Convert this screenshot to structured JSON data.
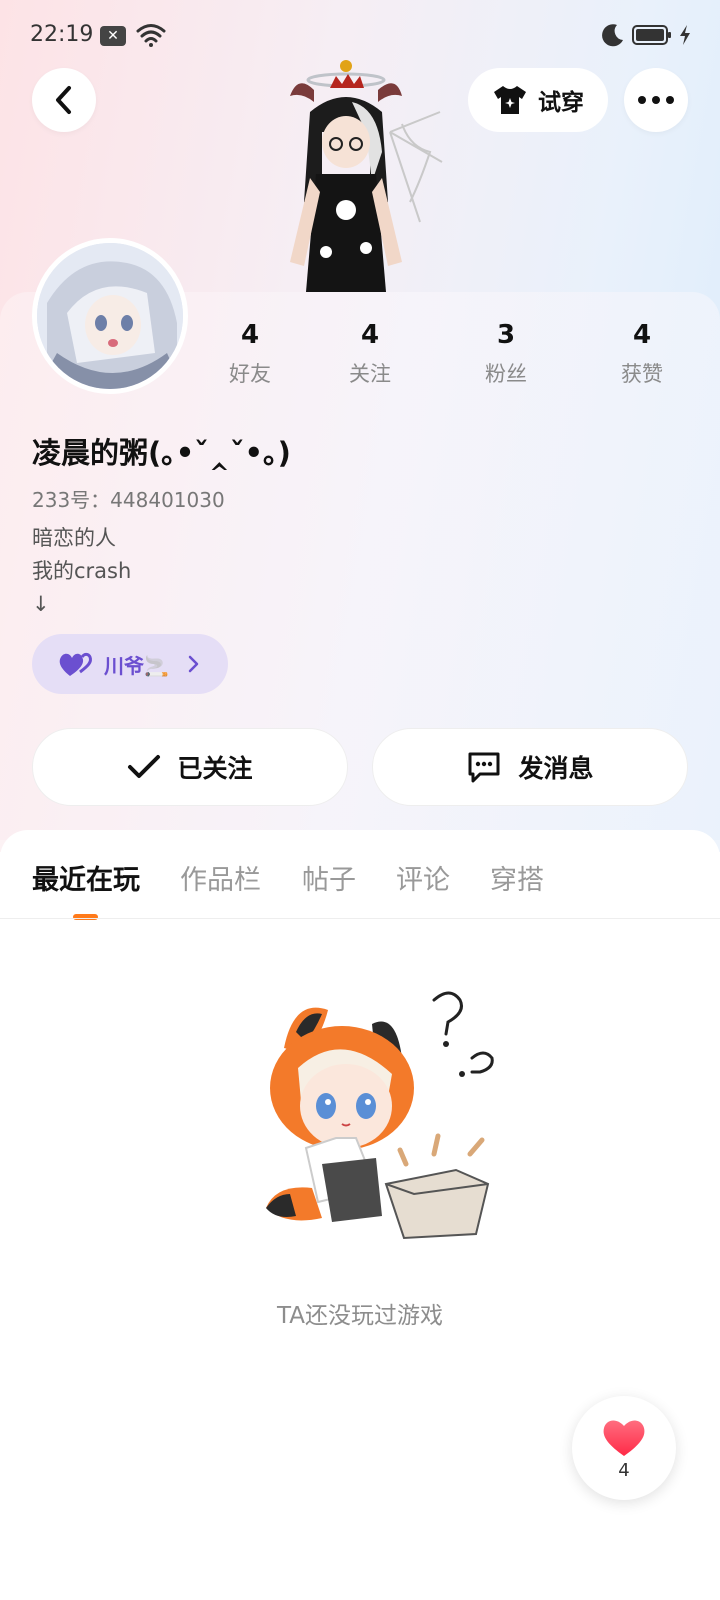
{
  "status_bar": {
    "time": "22:19",
    "notification_icon": "x-box-icon",
    "icons": [
      "wifi-icon",
      "moon-icon",
      "battery-icon",
      "charging-icon"
    ]
  },
  "header": {
    "back_icon": "chevron-left-icon",
    "tryon_label": "试穿",
    "tryon_icon": "tshirt-icon",
    "more_icon": "more-dots-icon"
  },
  "profile": {
    "stats": [
      {
        "value": "4",
        "label": "好友"
      },
      {
        "value": "4",
        "label": "关注"
      },
      {
        "value": "3",
        "label": "粉丝"
      },
      {
        "value": "4",
        "label": "获赞"
      }
    ],
    "nickname": "凌晨的粥(｡•ˇ‸ˇ•｡)",
    "uid": "233号：448401030",
    "bio_lines": [
      "暗恋的人",
      "我的crash",
      "↓"
    ],
    "cp_badge_label": "川爷🚬"
  },
  "actions": {
    "follow_label": "已关注",
    "message_label": "发消息"
  },
  "tabs": [
    "最近在玩",
    "作品栏",
    "帖子",
    "评论",
    "穿搭"
  ],
  "active_tab": "最近在玩",
  "empty_state": {
    "text": "TA还没玩过游戏"
  },
  "like_fab": {
    "count": "4"
  },
  "colors": {
    "accent": "#ff7a1a",
    "cp_badge_bg": "#e5def6",
    "cp_badge_text": "#6b4fd0",
    "like_heart": "#ff3b55"
  }
}
